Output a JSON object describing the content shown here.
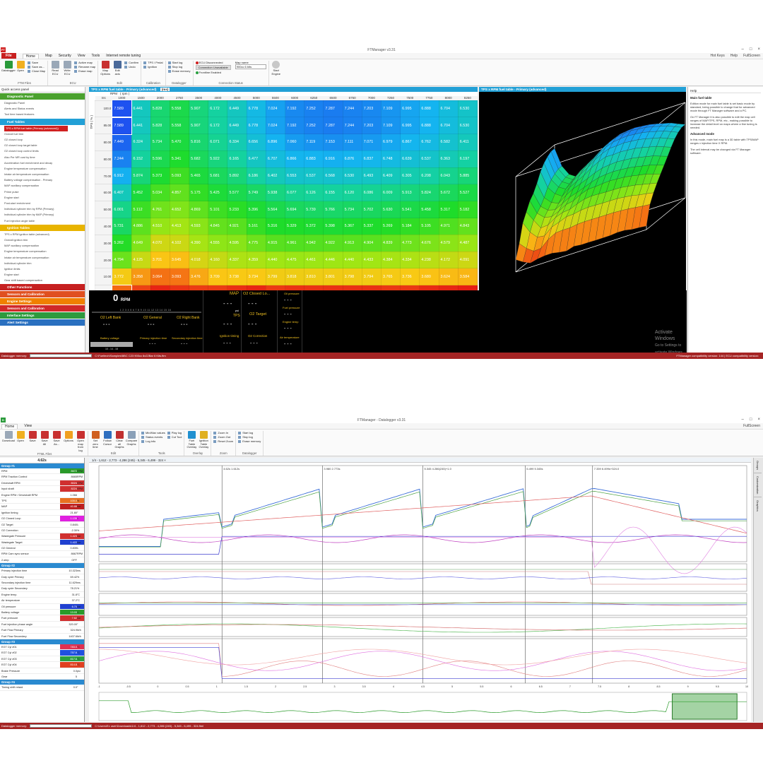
{
  "w1": {
    "title": "FTManager v3.31",
    "menu": [
      "File",
      "Home",
      "Map",
      "Security",
      "View",
      "Tools",
      "Internet remote tuning"
    ],
    "menu_right": [
      "Hot Keys",
      "Help",
      "FullScreen"
    ],
    "ribbon": {
      "datalogger": "Datalogger",
      "open": "Open",
      "files": [
        "Save",
        "Save as...",
        "Close Map"
      ],
      "files_label": "FTM Files",
      "read": "Read ECU",
      "write": "Write ECU",
      "ecu_small": [
        "Active map",
        "Rename map",
        "Erase map"
      ],
      "ecu_label": "ECU",
      "map_options": "Map Options",
      "edit_axis": "Edit axis",
      "edit_small": [
        "Confirm",
        "Undo"
      ],
      "edit_label": "Edit",
      "calib": [
        "TPS / Pedal",
        "Ignition"
      ],
      "calib_label": "Calibration",
      "dl_small": [
        "Start log",
        "Stop log",
        "Erase memory"
      ],
      "dl_label": "Datalogger",
      "conn": [
        "ECU Disconnected",
        "Connection Unavailable",
        "Frontline Enabled"
      ],
      "conn_label": "Connection Status",
      "map_name_label": "Map name",
      "map_name": "900cc 6 bits",
      "start_engine": "Start Engine"
    },
    "qap": {
      "header": "Quick access panel",
      "sections": [
        {
          "label": "Diagnostic Panel",
          "color": "#4aa12e",
          "items": [
            "Diagnostic Panel",
            "Alerts and Status events",
            "Tool time based features"
          ]
        },
        {
          "label": "Fuel Tables",
          "color": "#22a0d6",
          "items": [
            "TPS x RPM fuel table (Primary (advanced))",
            "Overall fuel trim",
            "O2 closed loop",
            "O2 closed loop target table",
            "O2 closed loop control limits",
            "Also Per MR cost by time",
            "Acceleration fuel enrichment and decay",
            "Engine temperature compensation",
            "Intake air temperature compensation",
            "Battery voltage compensation - Primary",
            "MAP auxiliary compensation",
            "Prime pulse",
            "Engine start",
            "Post-start enrichment",
            "Individual cylinder trim by RPM (Primary)",
            "Individual cylinder trim by MAP (Primary)",
            "Fuel injection angle table"
          ]
        },
        {
          "label": "Ignition Tables",
          "color": "#e8b400",
          "items": [
            "TPS x RPM ignition table (advanced)",
            "Overall ignition trim",
            "MAP auxiliary compensation",
            "Engine temperature compensation",
            "Intake air temperature compensation",
            "Individual cylinder trim",
            "Ignition limits",
            "Engine start",
            "Gear shift based compensation"
          ]
        }
      ],
      "sections_bottom": [
        {
          "label": "Other Functions",
          "color": "#c62020"
        },
        {
          "label": "Sensors and Calibration",
          "color": "#e05020"
        },
        {
          "label": "Engine Settings",
          "color": "#f08000"
        },
        {
          "label": "Sensors and Calibration",
          "color": "#d02828"
        },
        {
          "label": "Interface Settings",
          "color": "#2d9a3e"
        },
        {
          "label": "Alert Settings",
          "color": "#2a70c0"
        }
      ]
    },
    "table_title": "TPS x RPM fuel table - Primary (advanced)",
    "table_unit": "(ms)",
    "rpm_label": "RPM",
    "rpm_unit": "( rpm )",
    "tps_label": "TPS",
    "tps_unit": "( % )",
    "corner": "ms",
    "rpm": [
      "1000",
      "1500",
      "2000",
      "2750",
      "3500",
      "4000",
      "4500",
      "5000",
      "5500",
      "6000",
      "6250",
      "6500",
      "6750",
      "7000",
      "7250",
      "7500",
      "7750",
      "8000",
      "8250"
    ],
    "tps": [
      "100.0",
      "85.00",
      "80.00",
      "80.00",
      "70.00",
      "60.00",
      "50.00",
      "40.00",
      "30.00",
      "20.00",
      "10.00",
      "0.00"
    ],
    "cells": [
      [
        "7.589",
        "6.441",
        "5.828",
        "5.558",
        "5.907",
        "6.172",
        "6.449",
        "6.778",
        "7.024",
        "7.192",
        "7.252",
        "7.287",
        "7.244",
        "7.203",
        "7.109",
        "6.995",
        "6.888",
        "6.704",
        "6.530"
      ],
      [
        "7.589",
        "6.441",
        "5.828",
        "5.558",
        "5.907",
        "6.172",
        "6.449",
        "6.778",
        "7.024",
        "7.192",
        "7.252",
        "7.287",
        "7.244",
        "7.203",
        "7.109",
        "6.995",
        "6.888",
        "6.704",
        "6.530"
      ],
      [
        "7.449",
        "6.324",
        "5.734",
        "5.470",
        "5.816",
        "6.071",
        "6.334",
        "6.656",
        "6.896",
        "7.060",
        "7.119",
        "7.153",
        "7.111",
        "7.071",
        "6.979",
        "6.867",
        "6.762",
        "6.582",
        "6.411"
      ],
      [
        "7.244",
        "6.152",
        "5.596",
        "5.341",
        "5.682",
        "5.922",
        "6.165",
        "6.477",
        "6.707",
        "6.866",
        "6.883",
        "6.916",
        "6.876",
        "6.837",
        "6.748",
        "6.639",
        "6.537",
        "6.363",
        "6.197"
      ],
      [
        "6.912",
        "5.874",
        "5.373",
        "5.093",
        "5.465",
        "5.681",
        "5.892",
        "6.186",
        "6.402",
        "6.553",
        "6.537",
        "6.568",
        "6.530",
        "6.493",
        "6.409",
        "6.305",
        "6.208",
        "6.043",
        "5.885"
      ],
      [
        "6.407",
        "5.452",
        "5.034",
        "4.857",
        "5.175",
        "5.425",
        "5.577",
        "5.749",
        "5.938",
        "6.077",
        "6.126",
        "6.155",
        "6.120",
        "6.086",
        "6.009",
        "5.913",
        "5.824",
        "5.672",
        "5.527"
      ],
      [
        "6.001",
        "5.112",
        "4.761",
        "4.652",
        "4.869",
        "5.101",
        "5.233",
        "5.396",
        "5.564",
        "5.694",
        "5.739",
        "5.766",
        "5.734",
        "5.702",
        "5.630",
        "5.541",
        "5.458",
        "5.317",
        "5.182"
      ],
      [
        "5.731",
        "4.886",
        "4.510",
        "4.413",
        "4.593",
        "4.845",
        "4.921",
        "5.161",
        "5.316",
        "5.329",
        "5.372",
        "5.398",
        "5.367",
        "5.337",
        "5.269",
        "5.184",
        "5.105",
        "4.971",
        "4.843"
      ],
      [
        "5.262",
        "4.649",
        "4.070",
        "4.102",
        "4.390",
        "4.555",
        "4.595",
        "4.775",
        "4.915",
        "4.961",
        "4.942",
        "4.922",
        "4.913",
        "4.904",
        "4.839",
        "4.773",
        "4.676",
        "4.579",
        "4.487"
      ],
      [
        "4.794",
        "4.125",
        "3.701",
        "3.645",
        "4.018",
        "4.160",
        "4.337",
        "4.359",
        "4.440",
        "4.475",
        "4.461",
        "4.446",
        "4.440",
        "4.433",
        "4.384",
        "4.334",
        "4.238",
        "4.172",
        "4.091"
      ],
      [
        "3.772",
        "3.358",
        "3.064",
        "3.093",
        "3.476",
        "3.709",
        "3.738",
        "3.734",
        "3.799",
        "3.818",
        "3.810",
        "3.801",
        "3.798",
        "3.794",
        "3.765",
        "3.736",
        "3.680",
        "3.624",
        "3.584"
      ],
      [
        "3.010",
        "2.746",
        "2.541",
        "2.644",
        "2.701",
        "2.706",
        "2.620",
        "2.560",
        "2.695",
        "2.644",
        "2.648",
        "2.636",
        "2.635",
        "2.637",
        "2.680",
        "2.667",
        "2.581",
        "2.555",
        "2.504"
      ]
    ],
    "p3d_title": "TPS x RPM fuel table - Primary (advanced)",
    "help": {
      "tab": "Help",
      "h1": "Main fuel table",
      "p1": "Edition mode for main fuel table is set basic mode by standard, being possible to change that for advanced mode through FT Manager software and a PC.",
      "p2": "On FT Manager it is also possible to edit the map cell ranges of MAP/TPS, RPM, etc., making possible to increase the detail level on maps where a fine tuning is needed.",
      "h2": "Advanced mode",
      "p3": "In this mode, main fuel map is a 3D table with TPS/MAP ranges x injection time X RPM.",
      "p4": "The cell interval may be changed via FT Manager software."
    },
    "gauges": {
      "rpm_value": "0",
      "rpm_unit": "RPM",
      "o2_left": "O2 Left Bank",
      "o2_general": "O2 General",
      "o2_right": "O2 Right Bank",
      "battery": "Battery voltage",
      "primary_inj": "Primary injection time",
      "secondary_inj": "Secondary injection time",
      "map": "MAP",
      "o2_closed": "O2 Closed Lo...",
      "psi": "psi",
      "tps": "TPS",
      "o2_target": "O2 Target",
      "ign": "Ignition timing",
      "o2_corr": "O2 Correction",
      "oil": "Oil pressure",
      "fuel": "Fuel pressure",
      "eng": "Engine temp",
      "air": "Air temperature",
      "dash": "- - -",
      "scale": "10 - 14 - 18",
      "ticks": "1  2  3  4  5  6  7  8  9  10  11  12  13  14  15  16"
    },
    "watermark1": "Activate Windows",
    "watermark2": "Go to Settings to activate Windows.",
    "status_left": "Datalogger memory:",
    "status_path": "C:\\Fueltech\\Samples\\BBC C23 900cc 8x22Bar 6 Kits.ftm",
    "status_right": "FTManager compatibility version: 144 | ECU compatibility version:"
  },
  "w2": {
    "title": "FTManager - Datalogger v3.31",
    "menu": [
      "Home",
      "View"
    ],
    "menu_right": [
      "FullScreen"
    ],
    "ribbon": {
      "g1": [
        "Download",
        "Open",
        "Save",
        "Save All",
        "Save As...",
        "Options",
        "Open map from log"
      ],
      "g1_labels": [
        "ECU",
        "FTML Files"
      ],
      "g2": [
        "Set zero time",
        "Follow Cursor",
        "Clear all Graphs",
        "Compare Graphs"
      ],
      "g2_label": "Edit",
      "g3": [
        "Min/Max values",
        "Status events",
        "Log info",
        "Play log",
        "Cut Tool"
      ],
      "g3_label": "Tools",
      "g4": [
        "Fuel Table Overlay",
        "Ignition Table Overlay"
      ],
      "g4_label": "Overlay",
      "g5": [
        "Zoom In",
        "Zoom Out",
        "Reset Zoom"
      ],
      "g5_label": "Zoom",
      "g6": [
        "Start log",
        "Stop log",
        "Erase memory"
      ],
      "g6_label": "Datalogger"
    },
    "time": "4.62s",
    "log_tab": "1/4 - 1,612 - 2,773 - 4,286 (245) - 5,345 - 6,499 - 324",
    "groups": [
      {
        "name": "Group #1",
        "rows": [
          [
            "RPM",
            "8672",
            "RPM",
            "#2a9a2a"
          ],
          [
            "RPM Traction Control",
            "8665",
            "RPM",
            ""
          ],
          [
            "Driveshaft RPM",
            "8024",
            "RPM",
            "#d03030"
          ],
          [
            "Input shaft",
            "8224",
            "RPM",
            "#d03030"
          ],
          [
            "Engine RPM / Driveshaft RPM",
            "1.066",
            "",
            ""
          ],
          [
            "TPS",
            "100.0",
            "%",
            "#e87020"
          ],
          [
            "MAP",
            "40.88",
            "bar",
            "#c02020"
          ],
          [
            "Ignition timing",
            "21.80",
            "°",
            ""
          ],
          [
            "O2 Closed Loop",
            "1.139",
            "λ",
            "#e020e0"
          ],
          [
            "O2 Target",
            "0.840",
            "λ",
            ""
          ],
          [
            "O2 Correction",
            "-2.30",
            "%",
            ""
          ],
          [
            "Wastegate Pressure",
            "1.423",
            "bar",
            "#d03030"
          ],
          [
            "Wastegate Target",
            "1.422",
            "bar",
            "#2040d0"
          ],
          [
            "O2 General",
            "0.839",
            "λ",
            ""
          ],
          [
            "RPM Cam sync sensor",
            "8667",
            "RPM",
            ""
          ],
          [
            "2-step",
            "OFF",
            "",
            ""
          ]
        ]
      },
      {
        "name": "Group #2",
        "rows": [
          [
            "Primary injection time",
            "10.323",
            "ms",
            ""
          ],
          [
            "Duty cycle Primary",
            "69.42",
            "%",
            ""
          ],
          [
            "Secondary injection time",
            "11.629",
            "ms",
            ""
          ],
          [
            "Duty cycle Secondary",
            "78.21",
            "%",
            ""
          ],
          [
            "Engine temp.",
            "31.8",
            "°C",
            ""
          ],
          [
            "Air temperature",
            "37.2",
            "°C",
            ""
          ],
          [
            "Oil pressure",
            "6.70",
            "bar",
            "#2040d0"
          ],
          [
            "Battery voltage",
            "13.03",
            "V",
            "#2a9a2a"
          ],
          [
            "Fuel pressure",
            "7.62",
            "bar",
            "#d03030"
          ],
          [
            "Fuel injection phase angle",
            "320.00",
            "°",
            ""
          ],
          [
            "Fuel Flow Primary",
            "324.9",
            "lb/h",
            ""
          ],
          [
            "Fuel Flow Secondary",
            "1407.6",
            "lb/h",
            ""
          ]
        ]
      },
      {
        "name": "Group #3",
        "rows": [
          [
            "EGT Cyl #01",
            "783.0",
            "°C",
            "#e03050"
          ],
          [
            "EGT Cyl #02",
            "757.6",
            "°C",
            "#2050e0"
          ],
          [
            "EGT Cyl #03",
            "817.6",
            "°C",
            "#2aa040"
          ],
          [
            "EGT Cyl #04",
            "814.8",
            "°C",
            "#e04020"
          ],
          [
            "Brake Pressure",
            "0.0",
            "psi",
            ""
          ],
          [
            "Gear",
            "5",
            "",
            ""
          ]
        ]
      },
      {
        "name": "Group #4",
        "rows": [
          [
            "Timing shift retard",
            "0.0",
            "°",
            ""
          ]
        ]
      }
    ],
    "chart_labels": [
      "4.62s   1.612s",
      "3.980   2.773s",
      "5.345   4.286(245)+1.0",
      "6.499   5.345s",
      "7.339   6.499s+324.0"
    ],
    "x_ticks": [
      "-1",
      "-0.5",
      "0",
      "0.5",
      "1",
      "1.5",
      "2",
      "2.5",
      "3",
      "3.5",
      "4",
      "4.5",
      "5",
      "5.5",
      "6",
      "6.5",
      "7",
      "7.5",
      "8",
      "8.5",
      "9",
      "9.5",
      "10"
    ],
    "right_tabs": [
      "Groups",
      "Customization",
      "Graphics"
    ],
    "status_left": "Datalogger memory:",
    "status_path": "C:\\Users\\Ex user\\Downloads\\1/4 - 1,612 - 2,773 - 4,286 (245) - 5,345 - 6,499 - 324.ftml"
  }
}
